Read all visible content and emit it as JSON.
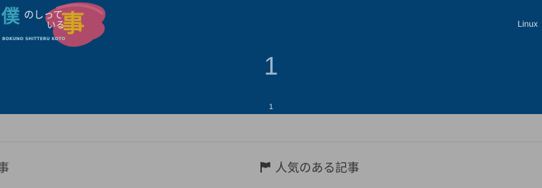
{
  "logo": {
    "main": "僕",
    "small_top": "のしって",
    "small_bottom": "いる",
    "big": "事",
    "sub": "BOKUNO SHITTERU KOTO"
  },
  "nav": {
    "linux": "Linux"
  },
  "page": {
    "title": "1",
    "subtitle": "1"
  },
  "sections": {
    "left_fragment": "事",
    "popular_label": "人気のある記事",
    "popular_icon": "flag-icon"
  },
  "colors": {
    "header_bg": "#034070",
    "overlay_bg": "#a9a9a9",
    "logo_accent": "#d2a820",
    "logo_splash": "#b04a6a"
  }
}
